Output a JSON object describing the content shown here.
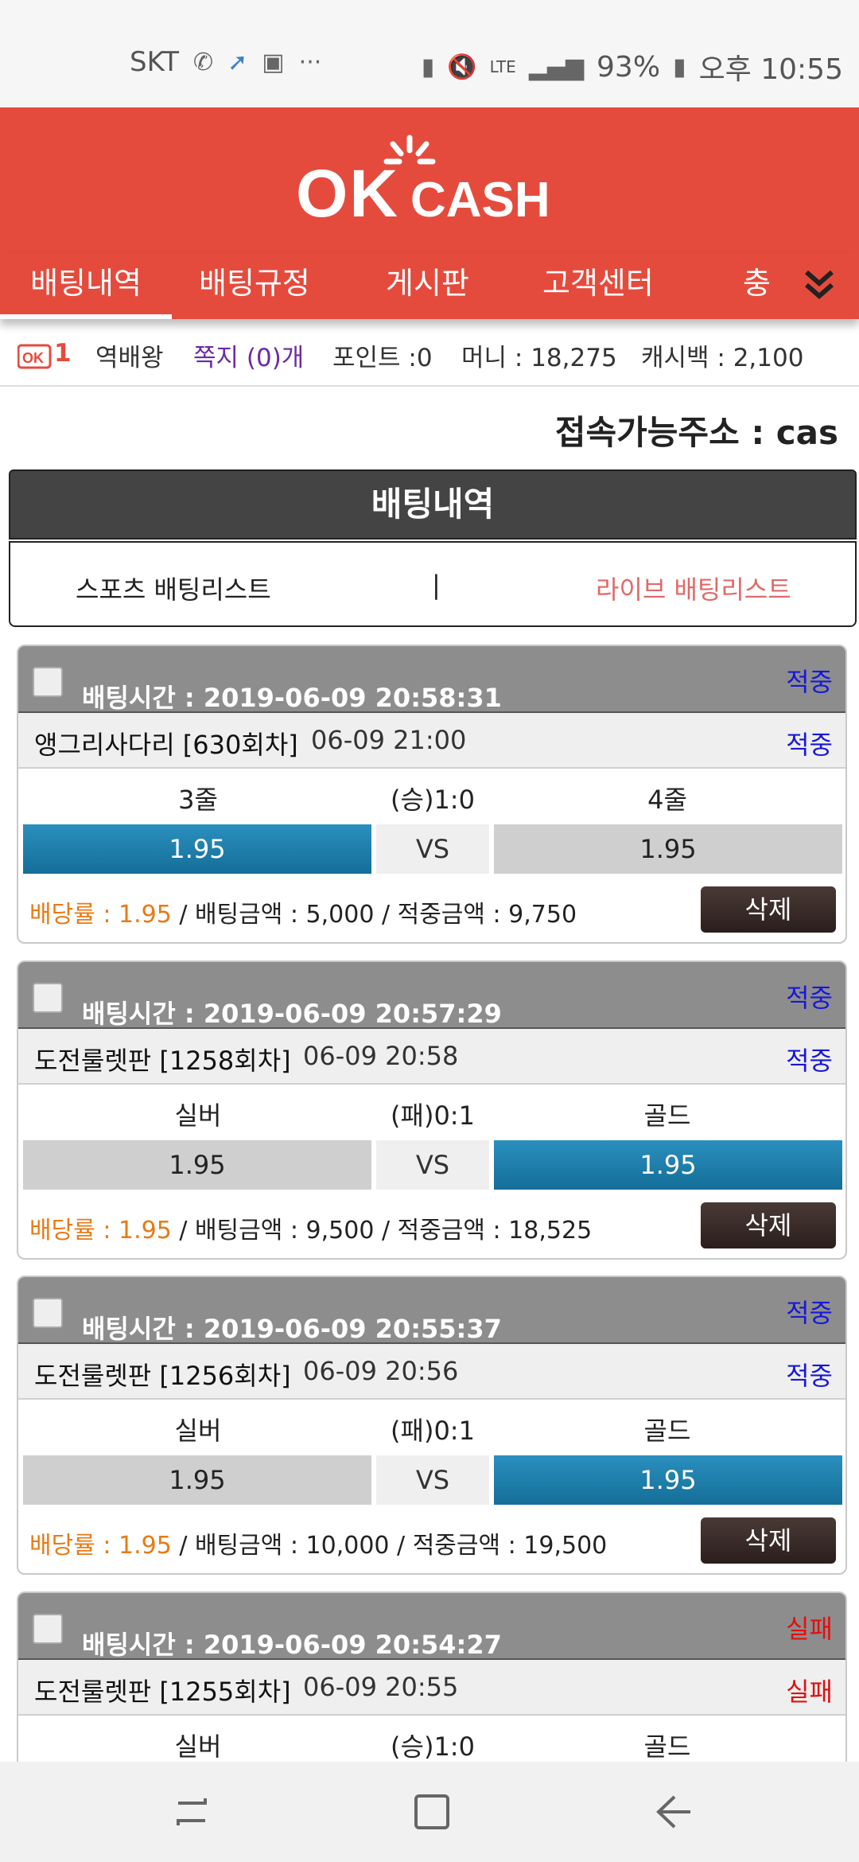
{
  "status_bar": {
    "carrier": "SKT",
    "battery": "93%",
    "time": "오후 10:55",
    "lte": "LTE"
  },
  "header": {
    "logo_ok": "OK",
    "logo_cash": "CASH",
    "brand_color": "#e54b3d"
  },
  "nav": {
    "items": [
      "배팅내역",
      "배팅규정",
      "게시판",
      "고객센터",
      "충"
    ]
  },
  "user": {
    "level_badge": "1",
    "nickname": "역배왕",
    "messages": "쪽지 (0)개",
    "points": "포인트 :0",
    "money": "머니 : 18,275",
    "cashback": "캐시백 : 2,100"
  },
  "access_address": "접속가능주소 : cas",
  "section_title": "배팅내역",
  "tabs": {
    "sports": "스포츠 배팅리스트",
    "separator": "|",
    "live": "라이브 배팅리스트"
  },
  "bets": [
    {
      "bet_time": "배팅시간 : 2019-06-09 20:58:31",
      "result": "적중",
      "game": "앵그리사다리  [630회차]",
      "game_time": "06-09 21:00",
      "home": "3줄",
      "score": "(승)1:0",
      "away": "4줄",
      "home_odds": "1.95",
      "vs": "VS",
      "away_odds": "1.95",
      "rate_text": "배당률 : 1.95",
      "amount_text": " / 배팅금액 : 5,000 / 적중금액 : 9,750",
      "delete": "삭제"
    },
    {
      "bet_time": "배팅시간 : 2019-06-09 20:57:29",
      "result": "적중",
      "game": "도전룰렛판  [1258회차]",
      "game_time": "06-09 20:58",
      "home": "실버",
      "score": "(패)0:1",
      "away": "골드",
      "home_odds": "1.95",
      "vs": "VS",
      "away_odds": "1.95",
      "rate_text": "배당률 : 1.95",
      "amount_text": " / 배팅금액 : 9,500 / 적중금액 : 18,525",
      "delete": "삭제"
    },
    {
      "bet_time": "배팅시간 : 2019-06-09 20:55:37",
      "result": "적중",
      "game": "도전룰렛판  [1256회차]",
      "game_time": "06-09 20:56",
      "home": "실버",
      "score": "(패)0:1",
      "away": "골드",
      "home_odds": "1.95",
      "vs": "VS",
      "away_odds": "1.95",
      "rate_text": "배당률 : 1.95",
      "amount_text": " / 배팅금액 : 10,000 / 적중금액 : 19,500",
      "delete": "삭제"
    },
    {
      "bet_time": "배팅시간 : 2019-06-09 20:54:27",
      "result": "실패",
      "game": "도전룰렛판  [1255회차]",
      "game_time": "06-09 20:55",
      "home": "실버",
      "score": "(승)1:0",
      "away": "골드"
    }
  ]
}
